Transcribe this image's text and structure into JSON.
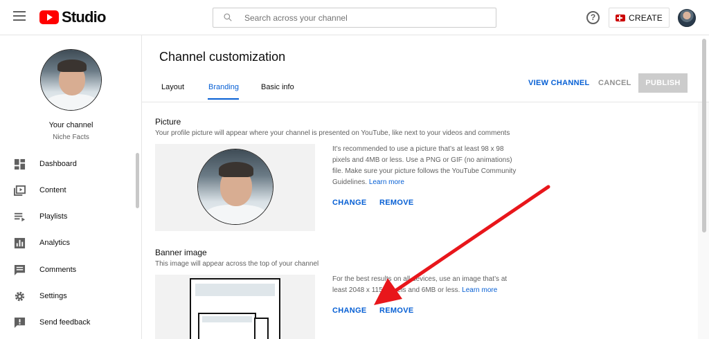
{
  "header": {
    "logo_text": "Studio",
    "search_placeholder": "Search across your channel",
    "create_label": "CREATE"
  },
  "sidebar": {
    "channel_title": "Your channel",
    "channel_name": "Niche Facts",
    "items": [
      {
        "label": "Dashboard",
        "icon": "dashboard-icon"
      },
      {
        "label": "Content",
        "icon": "content-icon"
      },
      {
        "label": "Playlists",
        "icon": "playlists-icon"
      },
      {
        "label": "Analytics",
        "icon": "analytics-icon"
      },
      {
        "label": "Comments",
        "icon": "comments-icon"
      },
      {
        "label": "Settings",
        "icon": "gear-icon"
      },
      {
        "label": "Send feedback",
        "icon": "feedback-icon"
      }
    ]
  },
  "page": {
    "title": "Channel customization",
    "tabs": [
      {
        "label": "Layout"
      },
      {
        "label": "Branding"
      },
      {
        "label": "Basic info"
      }
    ],
    "active_tab": "Branding",
    "view_channel": "VIEW CHANNEL",
    "cancel": "CANCEL",
    "publish": "PUBLISH"
  },
  "picture": {
    "title": "Picture",
    "description": "Your profile picture will appear where your channel is presented on YouTube, like next to your videos and comments",
    "info": "It’s recommended to use a picture that’s at least 98 x 98 pixels and 4MB or less. Use a PNG or GIF (no animations) file. Make sure your picture follows the YouTube Community Guidelines.",
    "learn_more": "Learn more",
    "change": "CHANGE",
    "remove": "REMOVE"
  },
  "banner": {
    "title": "Banner image",
    "description": "This image will appear across the top of your channel",
    "info": "For the best results on all devices, use an image that’s at least 2048 x 1152 pixels and 6MB or less.",
    "learn_more": "Learn more",
    "change": "CHANGE",
    "remove": "REMOVE"
  },
  "colors": {
    "accent": "#065fd4",
    "brand_red": "#ff0000",
    "annotation_arrow": "#e8161b"
  }
}
